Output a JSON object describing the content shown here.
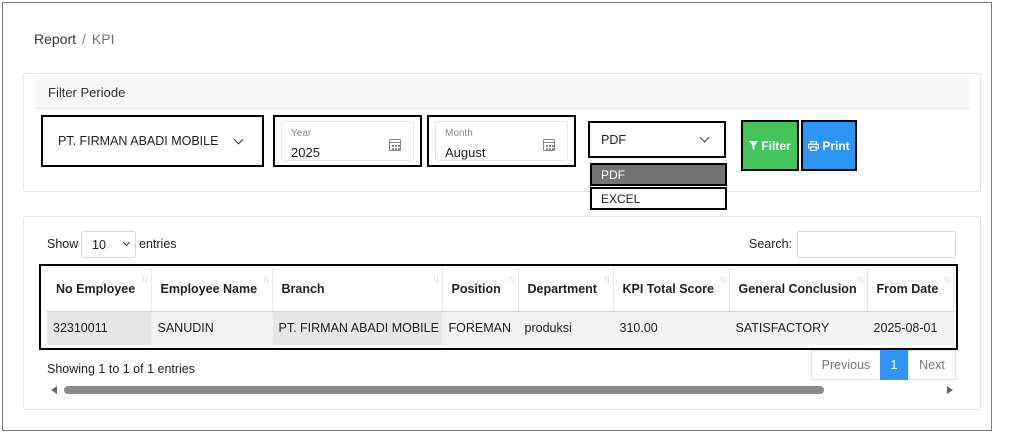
{
  "breadcrumb": {
    "parent": "Report",
    "separator": "/",
    "current": "KPI"
  },
  "filter": {
    "title": "Filter Periode",
    "company": "PT. FIRMAN ABADI MOBILE",
    "year": {
      "label": "Year",
      "value": "2025"
    },
    "month": {
      "label": "Month",
      "value": "August"
    },
    "format": {
      "selected": "PDF",
      "options": [
        "PDF",
        "EXCEL"
      ],
      "highlighted": "PDF"
    },
    "filter_button": "Filter",
    "print_button": "Print"
  },
  "table_controls": {
    "show_label": "Show",
    "length_value": "10",
    "entries_label": "entries",
    "search_label": "Search:",
    "search_value": ""
  },
  "table": {
    "columns": [
      "No Employee",
      "Employee Name",
      "Branch",
      "Position",
      "Department",
      "KPI Total Score",
      "General Conclusion",
      "From Date"
    ],
    "rows": [
      [
        "32310011",
        "SANUDIN",
        "PT. FIRMAN ABADI MOBILE",
        "FOREMAN",
        "produksi",
        "310.00",
        "SATISFACTORY",
        "2025-08-01"
      ]
    ]
  },
  "pagination": {
    "info": "Showing 1 to 1 of 1 entries",
    "previous": "Previous",
    "current_page": "1",
    "next": "Next"
  },
  "colors": {
    "filter_button": "#45c35d",
    "print_button": "#2f95f4",
    "active_page": "#2f95f4",
    "highlight_option": "#737373"
  },
  "icons": {
    "filter": "filter-icon",
    "print": "print-icon",
    "calendar": "calendar-icon",
    "sort": "sort-icon"
  }
}
